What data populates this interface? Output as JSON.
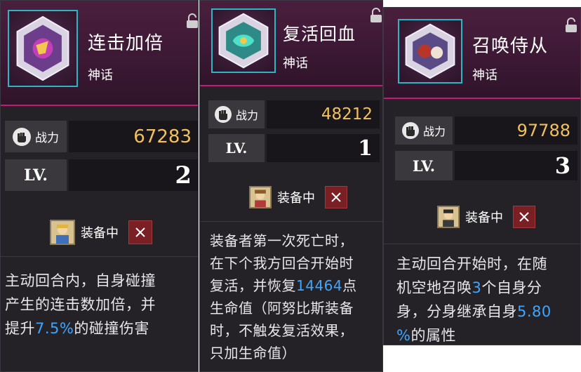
{
  "cards": [
    {
      "title": "连击加倍",
      "rarity": "神话",
      "power_label": "战力",
      "power_value": "67283",
      "lv_label": "LV.",
      "lv_value": "2",
      "equip_label": "装备中",
      "desc_lines": [
        {
          "pre": "主动回合内，自身碰撞",
          "hl": "",
          "post": ""
        },
        {
          "pre": "产生的连击数加倍，并",
          "hl": "",
          "post": ""
        },
        {
          "pre": "提升",
          "hl": "7.5%",
          "post": "的碰撞伤害"
        }
      ]
    },
    {
      "title": "复活回血",
      "rarity": "神话",
      "power_label": "战力",
      "power_value": "48212",
      "lv_label": "LV.",
      "lv_value": "1",
      "equip_label": "装备中",
      "desc_lines": [
        {
          "pre": "装备者第一次死亡时，",
          "hl": "",
          "post": ""
        },
        {
          "pre": "在下个我方回合开始时",
          "hl": "",
          "post": ""
        },
        {
          "pre": "复活，并恢复",
          "hl": "14464",
          "post": "点"
        },
        {
          "pre": "生命值（阿努比斯装备",
          "hl": "",
          "post": ""
        },
        {
          "pre": "时，不触发复活效果，",
          "hl": "",
          "post": ""
        },
        {
          "pre": "只加生命值）",
          "hl": "",
          "post": ""
        }
      ]
    },
    {
      "title": "召唤侍从",
      "rarity": "神话",
      "power_label": "战力",
      "power_value": "97788",
      "lv_label": "LV.",
      "lv_value": "3",
      "equip_label": "装备中",
      "desc_lines": [
        {
          "pre": "主动回合开始时，在随",
          "hl": "",
          "post": ""
        },
        {
          "pre": "机空地召唤",
          "hl": "3",
          "post": "个自身分"
        },
        {
          "pre": "身，分身继承自身",
          "hl": "5.80",
          "post": ""
        },
        {
          "pre": "",
          "hl": "%",
          "post": "的属性"
        }
      ]
    }
  ],
  "icons": {
    "lock": "padlock-open-icon",
    "power": "fist-icon",
    "unequip": "close-x-icon"
  },
  "colors": {
    "header_bg": "#3b1834",
    "header_accent": "#c21a78",
    "emblem_frame": "#2fb4c6",
    "power_value": "#f3c15b",
    "highlight": "#3ea6ff",
    "unequip_button": "#7a1f23"
  }
}
